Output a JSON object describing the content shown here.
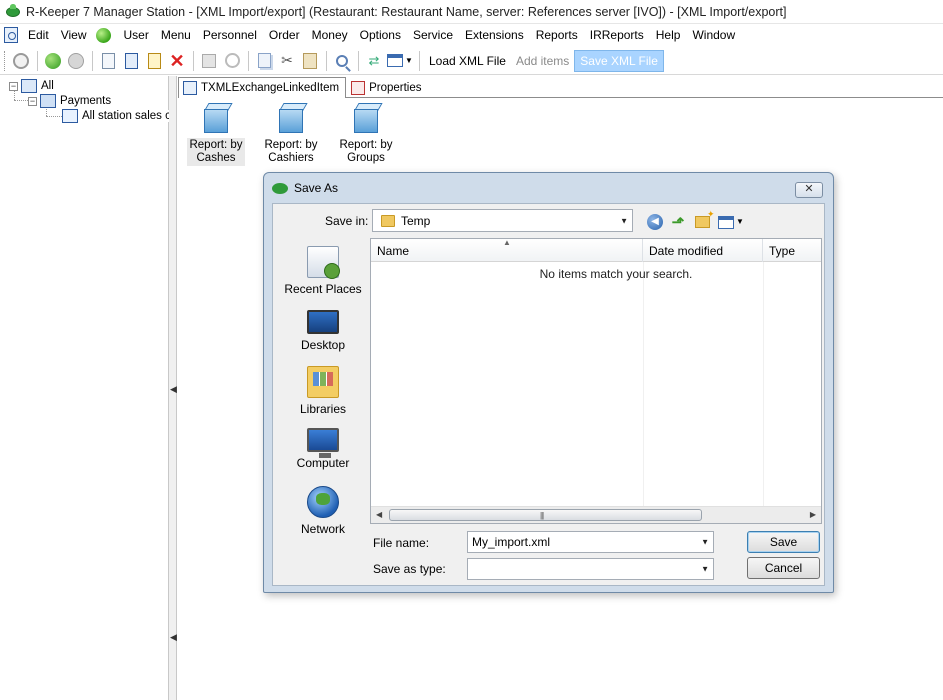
{
  "window": {
    "title": "R-Keeper 7 Manager Station - [XML Import/export] (Restaurant: Restaurant Name, server: References server [IVO]) - [XML Import/export]"
  },
  "menu": [
    {
      "label": "Edit"
    },
    {
      "label": "View"
    },
    {
      "label": "User"
    },
    {
      "label": "Menu"
    },
    {
      "label": "Personnel"
    },
    {
      "label": "Order"
    },
    {
      "label": "Money"
    },
    {
      "label": "Options"
    },
    {
      "label": "Service"
    },
    {
      "label": "Extensions"
    },
    {
      "label": "Reports"
    },
    {
      "label": "IRReports"
    },
    {
      "label": "Help"
    },
    {
      "label": "Window"
    }
  ],
  "toolbar": {
    "load_xml": "Load XML File",
    "add_items": "Add items",
    "save_xml": "Save XML File",
    "icons": [
      "refresh-icon",
      "back-icon",
      "forward-icon",
      "new-doc-icon",
      "edit-doc-icon",
      "export-icon",
      "delete-icon",
      "save-icon",
      "undo-icon",
      "copy-icon",
      "cut-icon",
      "paste-icon",
      "find-icon",
      "arrows-icon",
      "grid-icon"
    ]
  },
  "tree": {
    "root": "All",
    "child": "Payments",
    "leaf": "All station sales cu"
  },
  "tabs": [
    {
      "label": "TXMLExchangeLinkedItem"
    },
    {
      "label": "Properties"
    }
  ],
  "reports": [
    {
      "line1": "Report: by",
      "line2": "Cashes"
    },
    {
      "line1": "Report: by",
      "line2": "Cashiers"
    },
    {
      "line1": "Report: by",
      "line2": "Groups"
    }
  ],
  "dialog": {
    "title": "Save As",
    "save_in_label": "Save in:",
    "save_in_value": "Temp",
    "places": [
      {
        "label": "Recent Places",
        "icon": "recent-places-icon"
      },
      {
        "label": "Desktop",
        "icon": "desktop-icon"
      },
      {
        "label": "Libraries",
        "icon": "libraries-icon"
      },
      {
        "label": "Computer",
        "icon": "computer-icon"
      },
      {
        "label": "Network",
        "icon": "network-icon"
      }
    ],
    "columns": [
      "Name",
      "Date modified",
      "Type"
    ],
    "empty_message": "No items match your search.",
    "file_name_label": "File name:",
    "file_name_value": "My_import.xml",
    "save_as_type_label": "Save as type:",
    "save_as_type_value": "",
    "save_button": "Save",
    "cancel_button": "Cancel",
    "close_symbol": "✕"
  }
}
